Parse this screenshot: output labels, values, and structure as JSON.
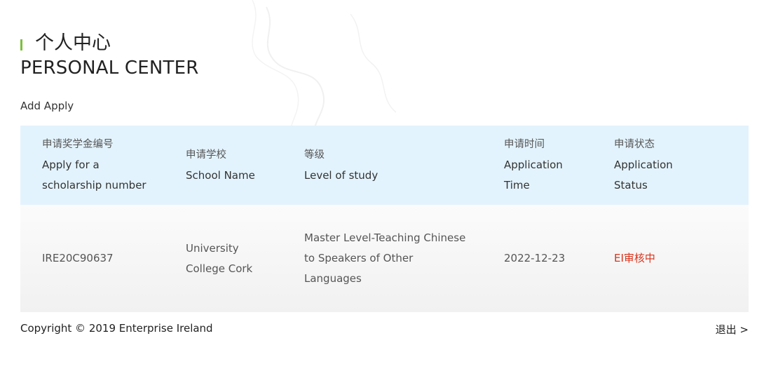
{
  "header": {
    "title_cn": "个人中心",
    "title_en": "PERSONAL CENTER"
  },
  "actions": {
    "add_apply": "Add Apply"
  },
  "table": {
    "columns": [
      {
        "cn": "申请奖学金编号",
        "en_lines": [
          "Apply for a",
          "scholarship number"
        ]
      },
      {
        "cn": "申请学校",
        "en_lines": [
          "School Name"
        ]
      },
      {
        "cn": "等级",
        "en_lines": [
          "Level of study"
        ]
      },
      {
        "cn": "申请时间",
        "en_lines": [
          "Application",
          "Time"
        ]
      },
      {
        "cn": "申请状态",
        "en_lines": [
          "Application",
          "Status"
        ]
      }
    ],
    "rows": [
      {
        "number": "IRE20C90637",
        "school_lines": [
          "University",
          "College Cork"
        ],
        "level_lines": [
          "Master Level-Teaching Chinese",
          "to Speakers of Other",
          "Languages"
        ],
        "time": "2022-12-23",
        "status": "EI审核中"
      }
    ]
  },
  "footer": {
    "copyright": "Copyright © 2019 Enterprise Ireland",
    "logout": "退出 >"
  },
  "colors": {
    "accent_bar": "#7cc03c",
    "header_bg": "#e3f3fd",
    "status_red": "#d9341d"
  }
}
